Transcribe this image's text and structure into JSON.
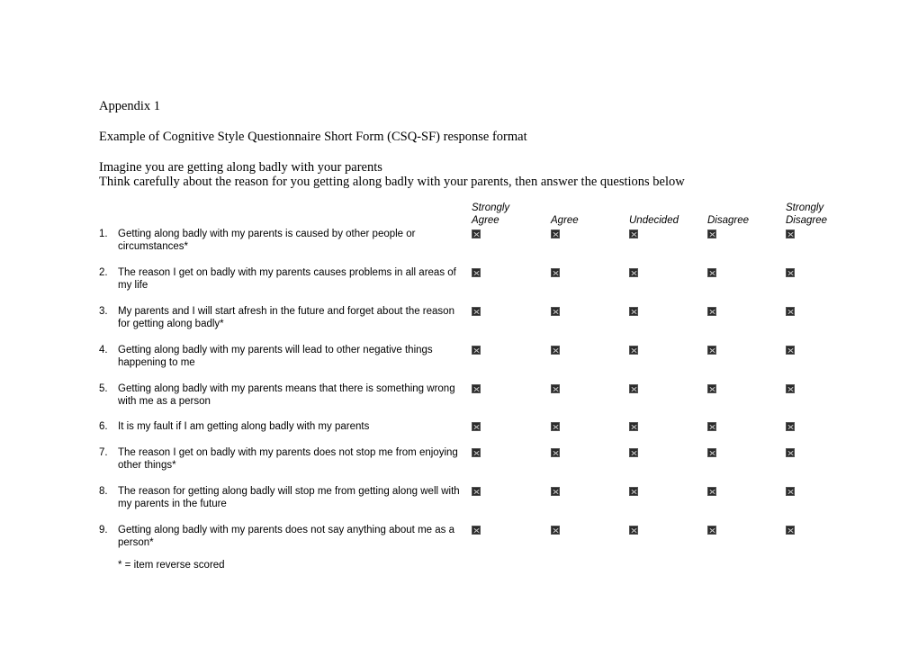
{
  "appendix_label": "Appendix 1",
  "subtitle": "Example of Cognitive Style Questionnaire Short Form (CSQ-SF) response format",
  "intro": [
    "Imagine you are getting along badly with your parents",
    "Think carefully about the reason for you getting along badly with your parents, then answer the questions below"
  ],
  "scale": [
    {
      "line1": "Strongly",
      "line2": "Agree"
    },
    {
      "line1": "",
      "line2": "Agree"
    },
    {
      "line1": "",
      "line2": "Undecided"
    },
    {
      "line1": "",
      "line2": "Disagree"
    },
    {
      "line1": "Strongly",
      "line2": "Disagree"
    }
  ],
  "items": [
    {
      "num": "1.",
      "text": "Getting along badly with my parents is caused by other people or circumstances*"
    },
    {
      "num": "2.",
      "text": "The reason I get on badly with my parents causes problems in all areas of my life"
    },
    {
      "num": "3.",
      "text": "My parents and I will start afresh in the future and forget about the reason for getting along badly*"
    },
    {
      "num": "4.",
      "text": "Getting along badly with my parents will lead to other negative things happening to me"
    },
    {
      "num": "5.",
      "text": "Getting along badly with my parents means that there is something wrong with me as a person"
    },
    {
      "num": "6.",
      "text": "It is my fault if I am getting along badly with my parents"
    },
    {
      "num": "7.",
      "text": "The reason I get on badly with my parents does not stop me from enjoying other things*"
    },
    {
      "num": "8.",
      "text": "The reason for getting along badly will stop me from getting along well with my parents in the future"
    },
    {
      "num": "9.",
      "text": "Getting along badly with my parents does not say anything about me as a person*"
    }
  ],
  "checkbox_icon": "checkbox-icon",
  "footnote": "* = item reverse scored"
}
